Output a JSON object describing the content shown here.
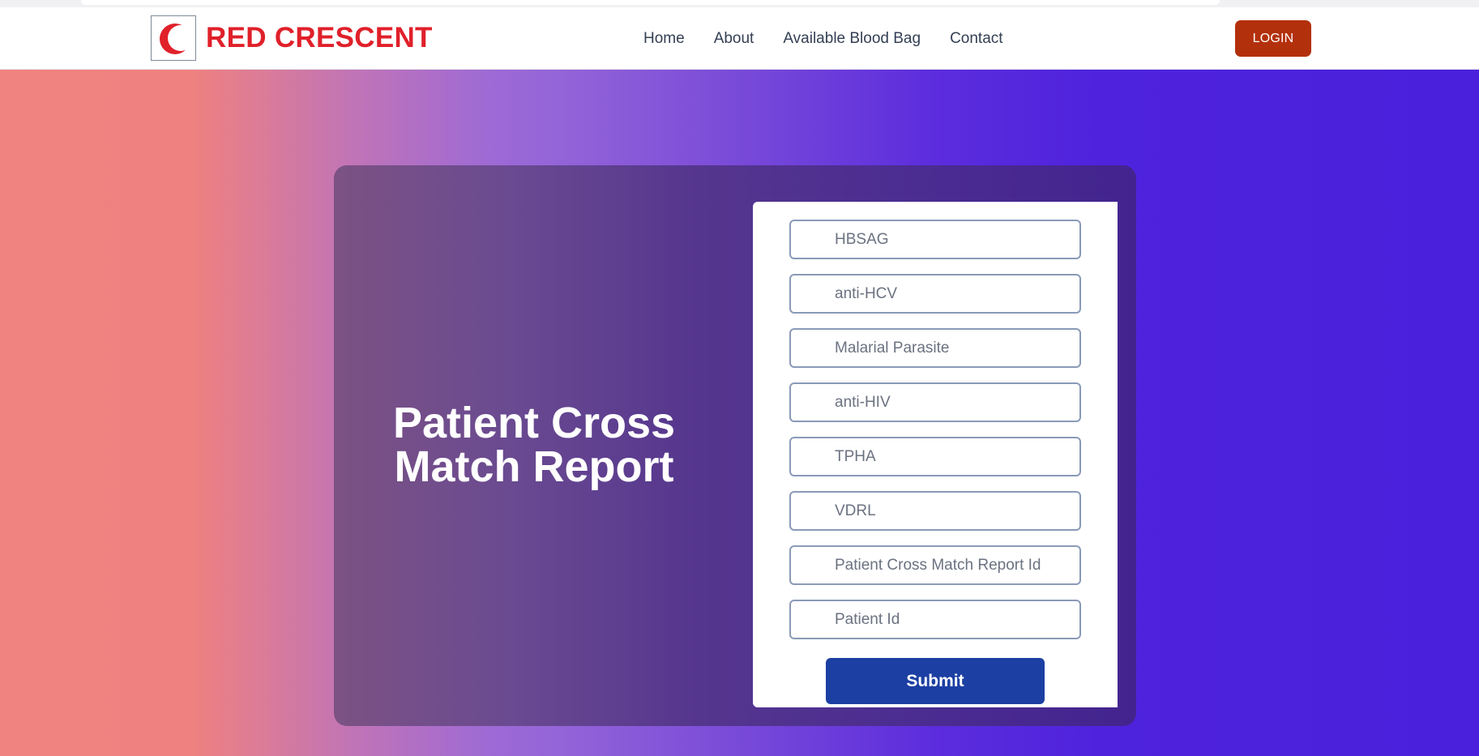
{
  "brand": {
    "name": "RED CRESCENT",
    "logo_icon": "red-crescent-icon",
    "color": "#e0202a"
  },
  "nav": {
    "links": [
      "Home",
      "About",
      "Available Blood Bag",
      "Contact"
    ],
    "login_label": "LOGIN",
    "login_color": "#b3300c"
  },
  "main": {
    "title": "Patient Cross Match Report",
    "form": {
      "fields": [
        {
          "placeholder": "HBSAG",
          "value": ""
        },
        {
          "placeholder": "anti-HCV",
          "value": ""
        },
        {
          "placeholder": "Malarial Parasite",
          "value": ""
        },
        {
          "placeholder": "anti-HIV",
          "value": ""
        },
        {
          "placeholder": "TPHA",
          "value": ""
        },
        {
          "placeholder": "VDRL",
          "value": ""
        },
        {
          "placeholder": "Patient Cross Match Report Id",
          "value": ""
        },
        {
          "placeholder": "Patient Id",
          "value": ""
        }
      ],
      "submit_label": "Submit",
      "submit_color": "#1c3fa3"
    }
  }
}
